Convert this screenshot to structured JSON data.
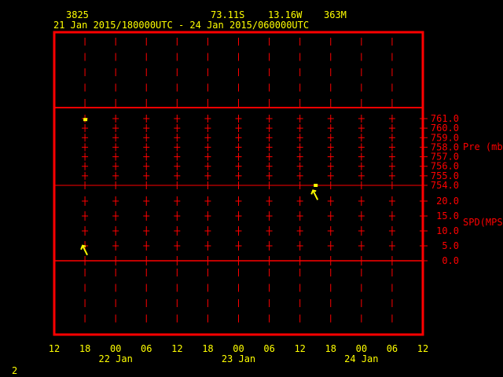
{
  "header": {
    "station_id": "3825",
    "latitude": "73.11S",
    "longitude": "13.16W",
    "elevation": "363M",
    "time_range": "21 Jan 2015/180000UTC - 24 Jan 2015/060000UTC"
  },
  "page_number": "2",
  "colors": {
    "frame": "#ff0000",
    "text": "#ffff00",
    "data": "#ffff00"
  },
  "chart_data": {
    "type": "scatter",
    "title": "3825  73.11S 13.16W 363M",
    "x_tick_labels": [
      "12",
      "18",
      "00",
      "06",
      "12",
      "18",
      "00",
      "06",
      "12",
      "18",
      "00",
      "06",
      "12"
    ],
    "x_hours_from_start": [
      0,
      6,
      12,
      18,
      24,
      30,
      36,
      42,
      48,
      54,
      60,
      66,
      72
    ],
    "x_start": "21 Jan 12Z",
    "date_labels": [
      {
        "label": "22 Jan",
        "hour": 12
      },
      {
        "label": "23 Jan",
        "hour": 36
      },
      {
        "label": "24 Jan",
        "hour": 60
      }
    ],
    "panels": [
      {
        "name": "pressure",
        "ylabel": "Pre (mb)",
        "ylim": [
          754,
          761
        ],
        "y_tick_labels": [
          "761.0",
          "760.0",
          "759.0",
          "758.0",
          "757.0",
          "756.0",
          "755.0",
          "754.0"
        ],
        "y_ticks": [
          761,
          760,
          759,
          758,
          757,
          756,
          755,
          754
        ],
        "series": [
          {
            "name": "Pressure",
            "points": [
              {
                "hour": 6,
                "value": 760.9
              },
              {
                "hour": 51,
                "value": 754.0
              }
            ]
          }
        ]
      },
      {
        "name": "wind_speed",
        "ylabel": "SPD(MPS)",
        "ylim": [
          0,
          20
        ],
        "y_tick_labels": [
          "20.0",
          "15.0",
          "10.0",
          "5.0",
          "0.0"
        ],
        "y_ticks": [
          20,
          15,
          10,
          5,
          0
        ],
        "series": [
          {
            "name": "Wind",
            "points": [
              {
                "hour": 6,
                "value": 3.5,
                "direction": "from-northwest"
              },
              {
                "hour": 51,
                "value": 22.0,
                "direction": "from-northwest"
              }
            ]
          }
        ]
      }
    ]
  }
}
